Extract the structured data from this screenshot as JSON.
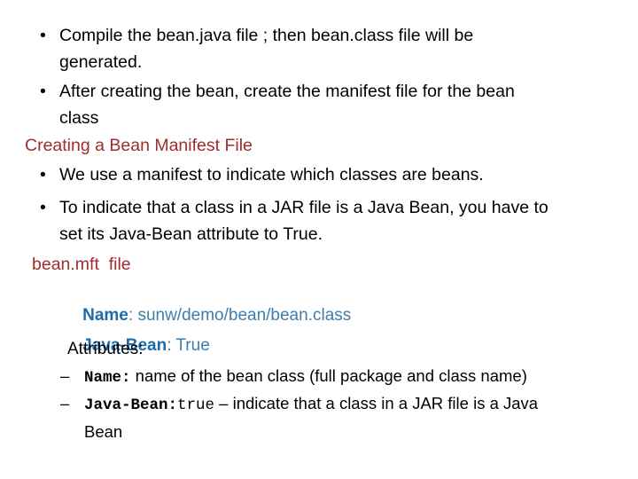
{
  "slide": {
    "background_color": "#FFFFFF",
    "body_text_color": "#000000",
    "heading_color": "#A02C2C",
    "key_color": "#1E6BA8",
    "value_color": "#3C7EA8",
    "bullet_glyph": "•",
    "dash_glyph": "–"
  },
  "bullets": {
    "compile": {
      "line1": "Compile  the  bean.java  file  ;  then    bean.class    file  will  be",
      "line2": "generated."
    },
    "after_creating": {
      "line1": "After creating the bean, create the manifest file for the bean",
      "line2": "class"
    },
    "manifest_indicate": {
      "line1": "We use a manifest to indicate which classes are beans."
    },
    "java_bean_attribute": {
      "line1": "To indicate that a class in a JAR file is a Java Bean, you have to",
      "line2": "set its Java-Bean attribute to True."
    }
  },
  "headings": {
    "creating_manifest": "Creating a Bean Manifest File",
    "bean_mft_file": "bean.mft  file"
  },
  "manifest": {
    "name": {
      "key": "Name",
      "sep": ": ",
      "value": "sunw/demo/bean/bean.class"
    },
    "java_bean": {
      "key": "Java-Bean",
      "sep": ": ",
      "value": "True"
    },
    "attributes_label": "Attributes:"
  },
  "attributes": {
    "name_attr": {
      "code": "Name:",
      "description": " name of the bean class (full package and class name)"
    },
    "java_bean_attr": {
      "code": "Java-Bean:",
      "code_value": "true",
      "description": " – indicate that a class in a JAR file is a Java",
      "description_cont": "Bean"
    }
  }
}
